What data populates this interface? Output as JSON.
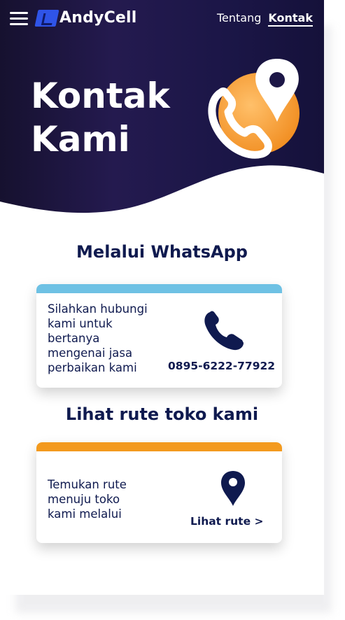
{
  "nav": {
    "brand": "AndyCell",
    "links": [
      {
        "label": "Tentang",
        "active": false
      },
      {
        "label": "Kontak",
        "active": true
      }
    ]
  },
  "hero": {
    "title_line1": "Kontak",
    "title_line2": "Kami"
  },
  "whatsapp": {
    "heading": "Melalui WhatsApp",
    "text_lines": [
      "Silahkan hubungi",
      "kami untuk",
      "bertanya",
      "mengenai jasa",
      "perbaikan kami"
    ],
    "phone": "0895-6222-77922",
    "bar_color": "#6ec1e4"
  },
  "route": {
    "heading": "Lihat rute toko kami",
    "text_lines": [
      "Temukan rute",
      "menuju toko",
      "kami melalui"
    ],
    "link_label": "Lihat rute >",
    "bar_color": "#f39a1e"
  },
  "colors": {
    "hero_dark": "#141036",
    "hero_purple": "#2a1f5c",
    "text_navy": "#0f1a4f",
    "accent_orange": "#f6a03a"
  },
  "icons": {
    "menu": "hamburger-menu-icon",
    "phone": "phone-icon",
    "location": "location-pin-icon"
  }
}
